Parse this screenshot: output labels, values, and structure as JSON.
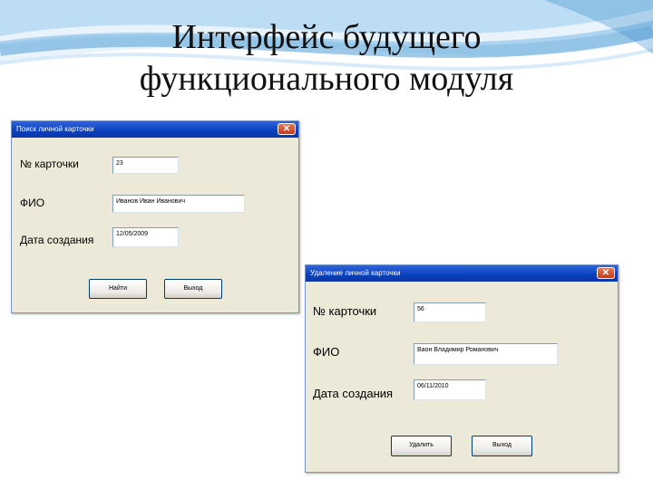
{
  "slide": {
    "title_line1": "Интерфейс будущего",
    "title_line2": "функционального модуля"
  },
  "search_window": {
    "title": "Поиск личной карточки",
    "card_no_label": "№ карточки",
    "card_no_value": "23",
    "fio_label": "ФИО",
    "fio_value": "Иванов Иван Иванович",
    "created_label": "Дата создания",
    "created_value": "12/05/2009",
    "find_button": "Найти",
    "exit_button": "Выход"
  },
  "delete_window": {
    "title": "Удаление личной карточки",
    "card_no_label": "№ карточки",
    "card_no_value": "56",
    "fio_label": "ФИО",
    "fio_value": "Ваон Владимир Романович",
    "created_label": "Дата создания",
    "created_value": "06/11/2010",
    "delete_button": "Удалить",
    "exit_button": "Выход"
  },
  "icons": {
    "close": "close-icon"
  },
  "colors": {
    "titlebar": "#0a3fbf",
    "window_bg": "#ece9d8",
    "swoosh": "#5ea6d8"
  }
}
